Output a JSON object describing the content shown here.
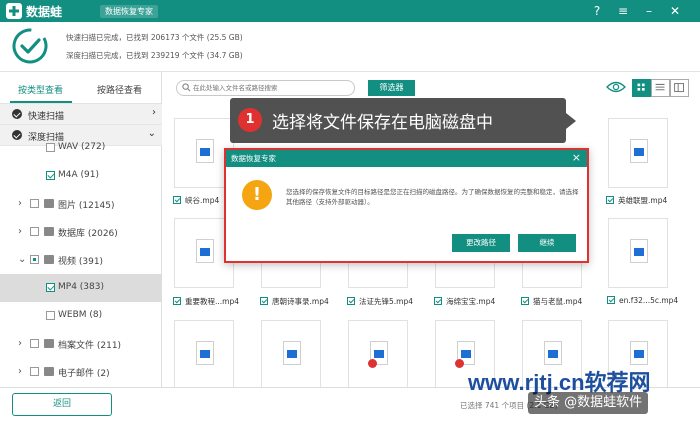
{
  "app": {
    "brand": "数据蛙",
    "subtitle": "数据恢复专家"
  },
  "scan": {
    "quick": "快速扫描已完成，已找到  206173 个文件  (25.5 GB)",
    "deep": "深度扫描已完成，已找到  239219 个文件  (34.7 GB)"
  },
  "sidebar": {
    "tabs": [
      "按类型查看",
      "按路径查看"
    ],
    "modes": [
      "快速扫描",
      "深度扫描"
    ],
    "tree": [
      {
        "label": "WAV (272)"
      },
      {
        "label": "M4A (91)"
      },
      {
        "label": "图片 (12145)"
      },
      {
        "label": "数据库 (2026)"
      },
      {
        "label": "视频 (391)"
      },
      {
        "label": "MP4 (383)"
      },
      {
        "label": "WEBM (8)"
      },
      {
        "label": "档案文件 (211)"
      },
      {
        "label": "电子邮件 (2)"
      }
    ]
  },
  "toolbar": {
    "search_placeholder": "在此处输入文件名或路径搜索",
    "filter_label": "筛选器"
  },
  "grid": {
    "row1_names": [
      "峡谷.mp4",
      "",
      "",
      "",
      "",
      "英雄联盟.mp4"
    ],
    "row2_names": [
      "重要教程...mp4",
      "唐朝诗事录.mp4",
      "法证先锋5.mp4",
      "海绵宝宝.mp4",
      "猫与老鼠.mp4",
      "en.f32...5c.mp4"
    ]
  },
  "callout": {
    "number": "1",
    "text": "选择将文件保存在电脑磁盘中"
  },
  "dialog": {
    "title": "数据恢复专家",
    "close": "×",
    "warn_symbol": "!",
    "message": "您选择的保存恢复文件的目标路径是您正在扫描的磁盘路径。为了确保数据恢复的完整和稳定，请选择其他路径（支持外部驱动器）。",
    "change_path": "更改路径",
    "continue": "继续"
  },
  "footer": {
    "back": "返回",
    "status": "已选择 741 个项目  (2.1 GB)"
  },
  "watermark": {
    "site": "www.rjtj.cn软荐网",
    "source": "头条 @数据蛙软件"
  },
  "colors": {
    "accent": "#138f82",
    "highlight": "#e03131",
    "warning": "#f5a511"
  }
}
